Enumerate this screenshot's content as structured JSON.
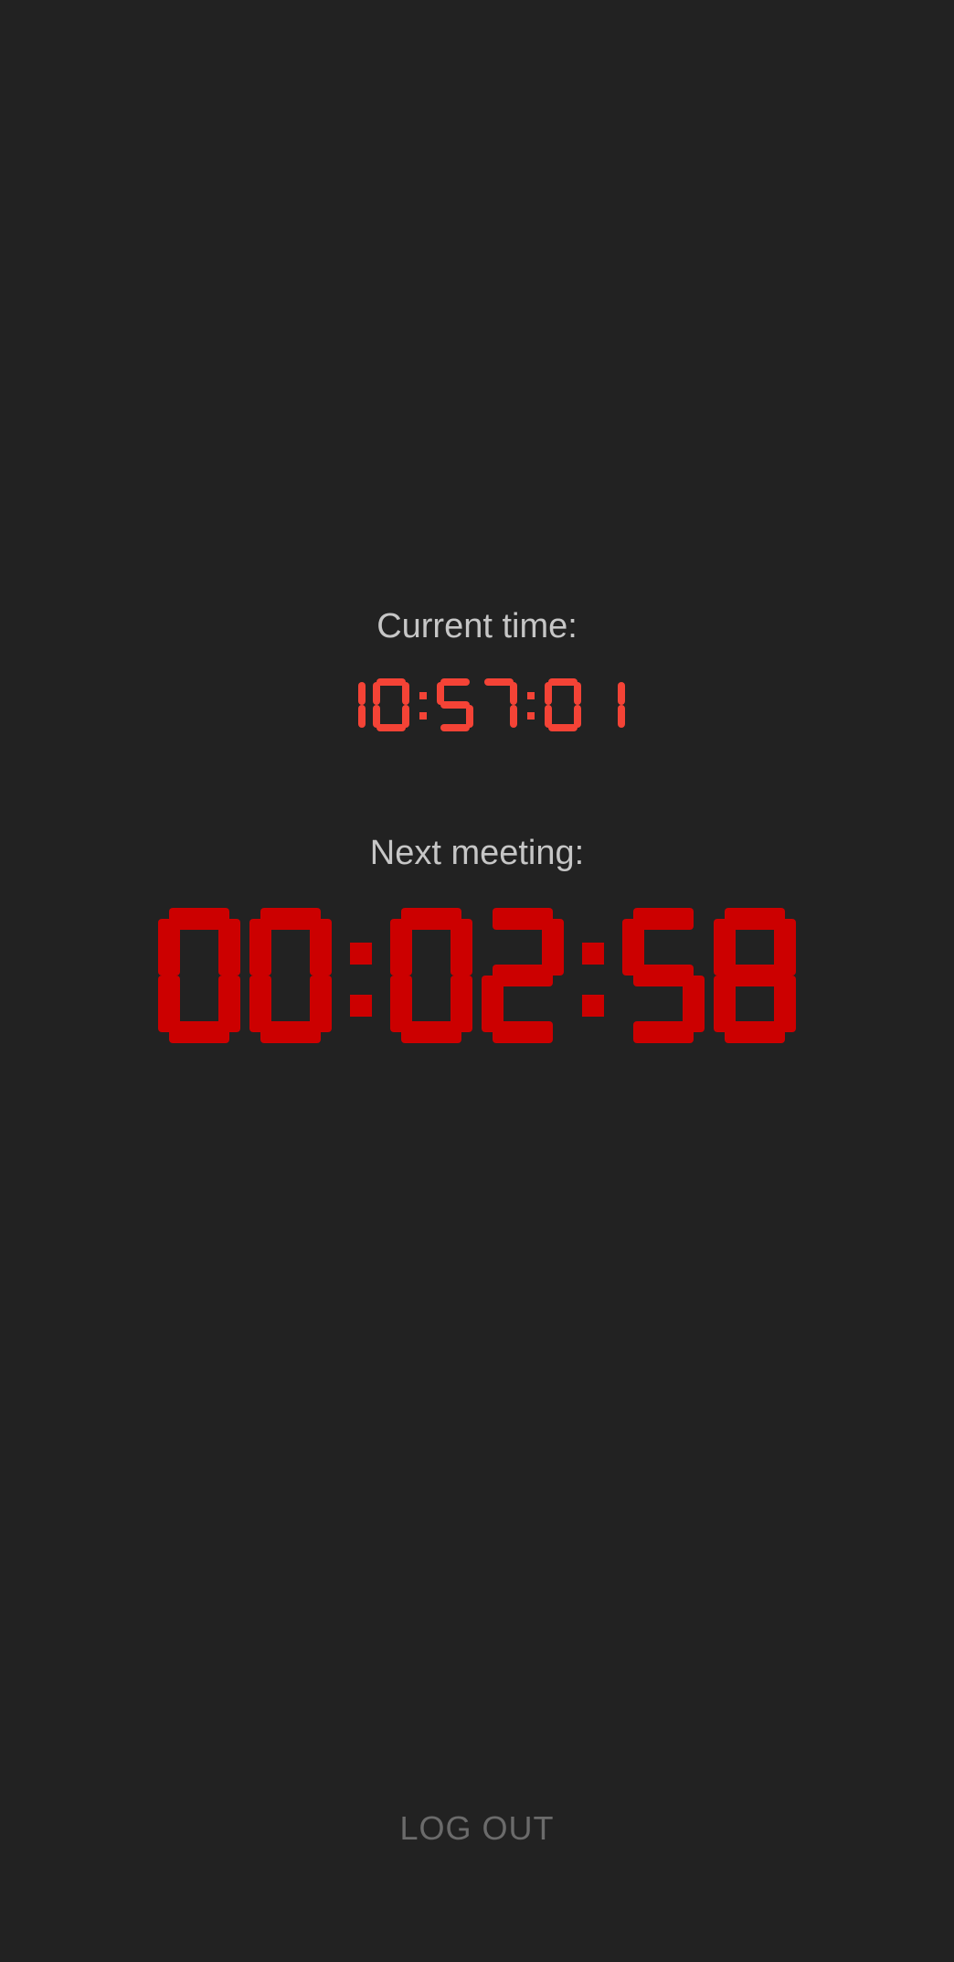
{
  "current_time": {
    "label": "Current time:",
    "value": "10:57:01",
    "color": "#f44336"
  },
  "next_meeting": {
    "label": "Next meeting:",
    "value": "00:02:58",
    "color": "#cc0000"
  },
  "logout_button": {
    "label": "LOG OUT",
    "color": "#6b6b6b"
  },
  "background_color": "#222222"
}
